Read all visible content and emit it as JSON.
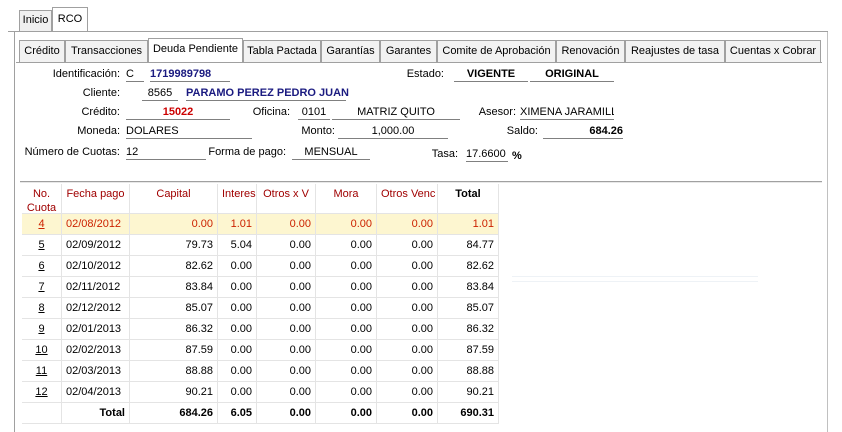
{
  "top_tabs": [
    "Inicio",
    "RCO"
  ],
  "sub_tabs": [
    "Crédito",
    "Transacciones",
    "Deuda Pendiente",
    "Tabla Pactada",
    "Garantías",
    "Garantes",
    "Comite de Aprobación",
    "Renovación",
    "Reajustes de tasa",
    "Cuentas x Cobrar"
  ],
  "form": {
    "identificacion_label": "Identificación:",
    "identificacion_tipo": "C",
    "identificacion_num": "1719989798",
    "estado_label": "Estado:",
    "estado_val1": "VIGENTE",
    "estado_val2": "ORIGINAL",
    "cliente_label": "Cliente:",
    "cliente_code": "8565",
    "cliente_name": "PARAMO PEREZ PEDRO JUAN",
    "credito_label": "Crédito:",
    "credito_val": "15022",
    "oficina_label": "Oficina:",
    "oficina_code": "0101",
    "oficina_name": "MATRIZ QUITO",
    "asesor_label": "Asesor:",
    "asesor_val": "XIMENA JARAMILLO",
    "moneda_label": "Moneda:",
    "moneda_val": "DOLARES",
    "monto_label": "Monto:",
    "monto_val": "1,000.00",
    "saldo_label": "Saldo:",
    "saldo_val": "684.26",
    "cuotas_label": "Número de Cuotas:",
    "cuotas_val": "12",
    "forma_label": "Forma de pago:",
    "forma_val": "MENSUAL",
    "tasa_label": "Tasa:",
    "tasa_val": "17.6600",
    "tasa_unit": "%"
  },
  "table": {
    "headers": {
      "no": "No.",
      "cuota": "Cuota",
      "fecha": "Fecha pago",
      "capital": "Capital",
      "interes": "Interes",
      "otros_xv": "Otros x V",
      "mora": "Mora",
      "otros_venc": "Otros Venc",
      "total": "Total"
    },
    "rows": [
      {
        "no": "4",
        "fecha": "02/08/2012",
        "capital": "0.00",
        "interes": "1.01",
        "otros_xv": "0.00",
        "mora": "0.00",
        "otros_venc": "0.00",
        "total": "1.01"
      },
      {
        "no": "5",
        "fecha": "02/09/2012",
        "capital": "79.73",
        "interes": "5.04",
        "otros_xv": "0.00",
        "mora": "0.00",
        "otros_venc": "0.00",
        "total": "84.77"
      },
      {
        "no": "6",
        "fecha": "02/10/2012",
        "capital": "82.62",
        "interes": "0.00",
        "otros_xv": "0.00",
        "mora": "0.00",
        "otros_venc": "0.00",
        "total": "82.62"
      },
      {
        "no": "7",
        "fecha": "02/11/2012",
        "capital": "83.84",
        "interes": "0.00",
        "otros_xv": "0.00",
        "mora": "0.00",
        "otros_venc": "0.00",
        "total": "83.84"
      },
      {
        "no": "8",
        "fecha": "02/12/2012",
        "capital": "85.07",
        "interes": "0.00",
        "otros_xv": "0.00",
        "mora": "0.00",
        "otros_venc": "0.00",
        "total": "85.07"
      },
      {
        "no": "9",
        "fecha": "02/01/2013",
        "capital": "86.32",
        "interes": "0.00",
        "otros_xv": "0.00",
        "mora": "0.00",
        "otros_venc": "0.00",
        "total": "86.32"
      },
      {
        "no": "10",
        "fecha": "02/02/2013",
        "capital": "87.59",
        "interes": "0.00",
        "otros_xv": "0.00",
        "mora": "0.00",
        "otros_venc": "0.00",
        "total": "87.59"
      },
      {
        "no": "11",
        "fecha": "02/03/2013",
        "capital": "88.88",
        "interes": "0.00",
        "otros_xv": "0.00",
        "mora": "0.00",
        "otros_venc": "0.00",
        "total": "88.88"
      },
      {
        "no": "12",
        "fecha": "02/04/2013",
        "capital": "90.21",
        "interes": "0.00",
        "otros_xv": "0.00",
        "mora": "0.00",
        "otros_venc": "0.00",
        "total": "90.21"
      }
    ],
    "totals": {
      "label": "Total",
      "capital": "684.26",
      "interes": "6.05",
      "otros_xv": "0.00",
      "mora": "0.00",
      "otros_venc": "0.00",
      "total": "690.31"
    }
  }
}
